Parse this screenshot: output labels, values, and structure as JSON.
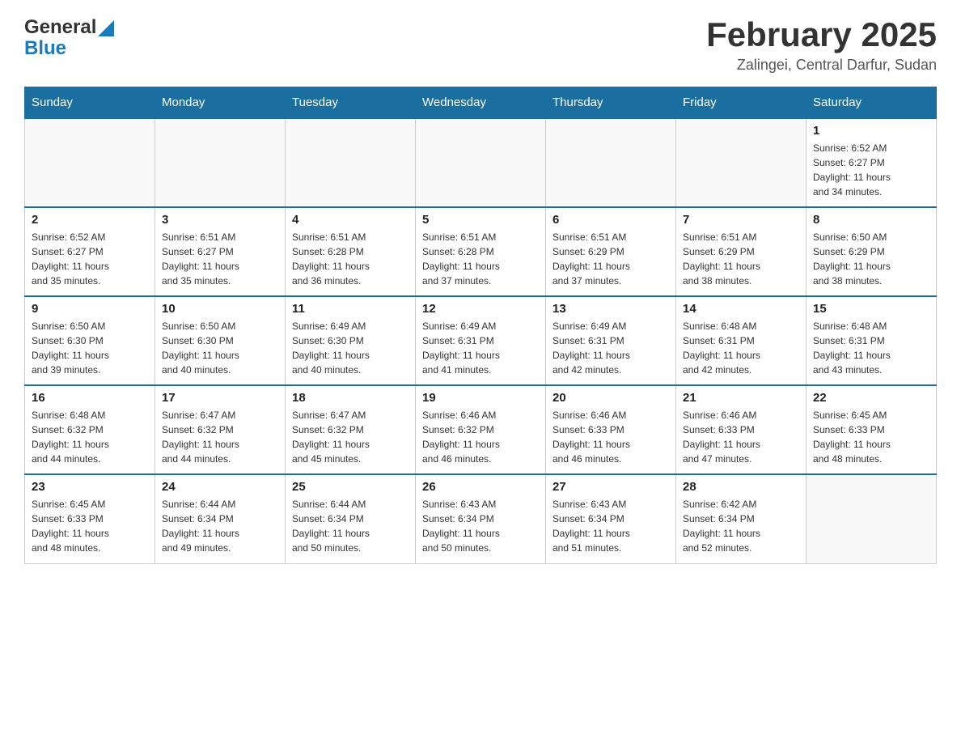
{
  "logo": {
    "general": "General",
    "blue": "Blue"
  },
  "title": {
    "month": "February 2025",
    "location": "Zalingei, Central Darfur, Sudan"
  },
  "days_of_week": [
    "Sunday",
    "Monday",
    "Tuesday",
    "Wednesday",
    "Thursday",
    "Friday",
    "Saturday"
  ],
  "weeks": [
    [
      {
        "day": "",
        "info": ""
      },
      {
        "day": "",
        "info": ""
      },
      {
        "day": "",
        "info": ""
      },
      {
        "day": "",
        "info": ""
      },
      {
        "day": "",
        "info": ""
      },
      {
        "day": "",
        "info": ""
      },
      {
        "day": "1",
        "info": "Sunrise: 6:52 AM\nSunset: 6:27 PM\nDaylight: 11 hours\nand 34 minutes."
      }
    ],
    [
      {
        "day": "2",
        "info": "Sunrise: 6:52 AM\nSunset: 6:27 PM\nDaylight: 11 hours\nand 35 minutes."
      },
      {
        "day": "3",
        "info": "Sunrise: 6:51 AM\nSunset: 6:27 PM\nDaylight: 11 hours\nand 35 minutes."
      },
      {
        "day": "4",
        "info": "Sunrise: 6:51 AM\nSunset: 6:28 PM\nDaylight: 11 hours\nand 36 minutes."
      },
      {
        "day": "5",
        "info": "Sunrise: 6:51 AM\nSunset: 6:28 PM\nDaylight: 11 hours\nand 37 minutes."
      },
      {
        "day": "6",
        "info": "Sunrise: 6:51 AM\nSunset: 6:29 PM\nDaylight: 11 hours\nand 37 minutes."
      },
      {
        "day": "7",
        "info": "Sunrise: 6:51 AM\nSunset: 6:29 PM\nDaylight: 11 hours\nand 38 minutes."
      },
      {
        "day": "8",
        "info": "Sunrise: 6:50 AM\nSunset: 6:29 PM\nDaylight: 11 hours\nand 38 minutes."
      }
    ],
    [
      {
        "day": "9",
        "info": "Sunrise: 6:50 AM\nSunset: 6:30 PM\nDaylight: 11 hours\nand 39 minutes."
      },
      {
        "day": "10",
        "info": "Sunrise: 6:50 AM\nSunset: 6:30 PM\nDaylight: 11 hours\nand 40 minutes."
      },
      {
        "day": "11",
        "info": "Sunrise: 6:49 AM\nSunset: 6:30 PM\nDaylight: 11 hours\nand 40 minutes."
      },
      {
        "day": "12",
        "info": "Sunrise: 6:49 AM\nSunset: 6:31 PM\nDaylight: 11 hours\nand 41 minutes."
      },
      {
        "day": "13",
        "info": "Sunrise: 6:49 AM\nSunset: 6:31 PM\nDaylight: 11 hours\nand 42 minutes."
      },
      {
        "day": "14",
        "info": "Sunrise: 6:48 AM\nSunset: 6:31 PM\nDaylight: 11 hours\nand 42 minutes."
      },
      {
        "day": "15",
        "info": "Sunrise: 6:48 AM\nSunset: 6:31 PM\nDaylight: 11 hours\nand 43 minutes."
      }
    ],
    [
      {
        "day": "16",
        "info": "Sunrise: 6:48 AM\nSunset: 6:32 PM\nDaylight: 11 hours\nand 44 minutes."
      },
      {
        "day": "17",
        "info": "Sunrise: 6:47 AM\nSunset: 6:32 PM\nDaylight: 11 hours\nand 44 minutes."
      },
      {
        "day": "18",
        "info": "Sunrise: 6:47 AM\nSunset: 6:32 PM\nDaylight: 11 hours\nand 45 minutes."
      },
      {
        "day": "19",
        "info": "Sunrise: 6:46 AM\nSunset: 6:32 PM\nDaylight: 11 hours\nand 46 minutes."
      },
      {
        "day": "20",
        "info": "Sunrise: 6:46 AM\nSunset: 6:33 PM\nDaylight: 11 hours\nand 46 minutes."
      },
      {
        "day": "21",
        "info": "Sunrise: 6:46 AM\nSunset: 6:33 PM\nDaylight: 11 hours\nand 47 minutes."
      },
      {
        "day": "22",
        "info": "Sunrise: 6:45 AM\nSunset: 6:33 PM\nDaylight: 11 hours\nand 48 minutes."
      }
    ],
    [
      {
        "day": "23",
        "info": "Sunrise: 6:45 AM\nSunset: 6:33 PM\nDaylight: 11 hours\nand 48 minutes."
      },
      {
        "day": "24",
        "info": "Sunrise: 6:44 AM\nSunset: 6:34 PM\nDaylight: 11 hours\nand 49 minutes."
      },
      {
        "day": "25",
        "info": "Sunrise: 6:44 AM\nSunset: 6:34 PM\nDaylight: 11 hours\nand 50 minutes."
      },
      {
        "day": "26",
        "info": "Sunrise: 6:43 AM\nSunset: 6:34 PM\nDaylight: 11 hours\nand 50 minutes."
      },
      {
        "day": "27",
        "info": "Sunrise: 6:43 AM\nSunset: 6:34 PM\nDaylight: 11 hours\nand 51 minutes."
      },
      {
        "day": "28",
        "info": "Sunrise: 6:42 AM\nSunset: 6:34 PM\nDaylight: 11 hours\nand 52 minutes."
      },
      {
        "day": "",
        "info": ""
      }
    ]
  ]
}
